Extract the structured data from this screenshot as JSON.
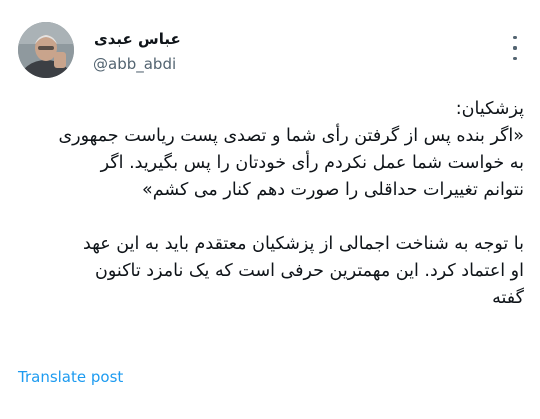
{
  "post": {
    "author_name": "عباس عبدی",
    "handle": "@abb_abdi",
    "body_lines": [
      "پزشکیان:",
      "«اگر بنده پس از گرفتن رأی شما و تصدی پست ریاست جمهوری",
      "به خواست شما عمل نکردم رأی خودتان را پس بگیرید. اگر",
      "نتوانم تغییرات حداقلی را صورت دهم کنار می کشم»",
      "با توجه به شناخت اجمالی از پزشکیان معتقدم باید به این عهد",
      "او اعتماد کرد. این مهمترین حرفی است که یک نامزد تاکنون",
      "گفته"
    ],
    "translate_label": "Translate post",
    "more_icon": "more-vertical-icon",
    "link_color": "#1d9bf0"
  }
}
